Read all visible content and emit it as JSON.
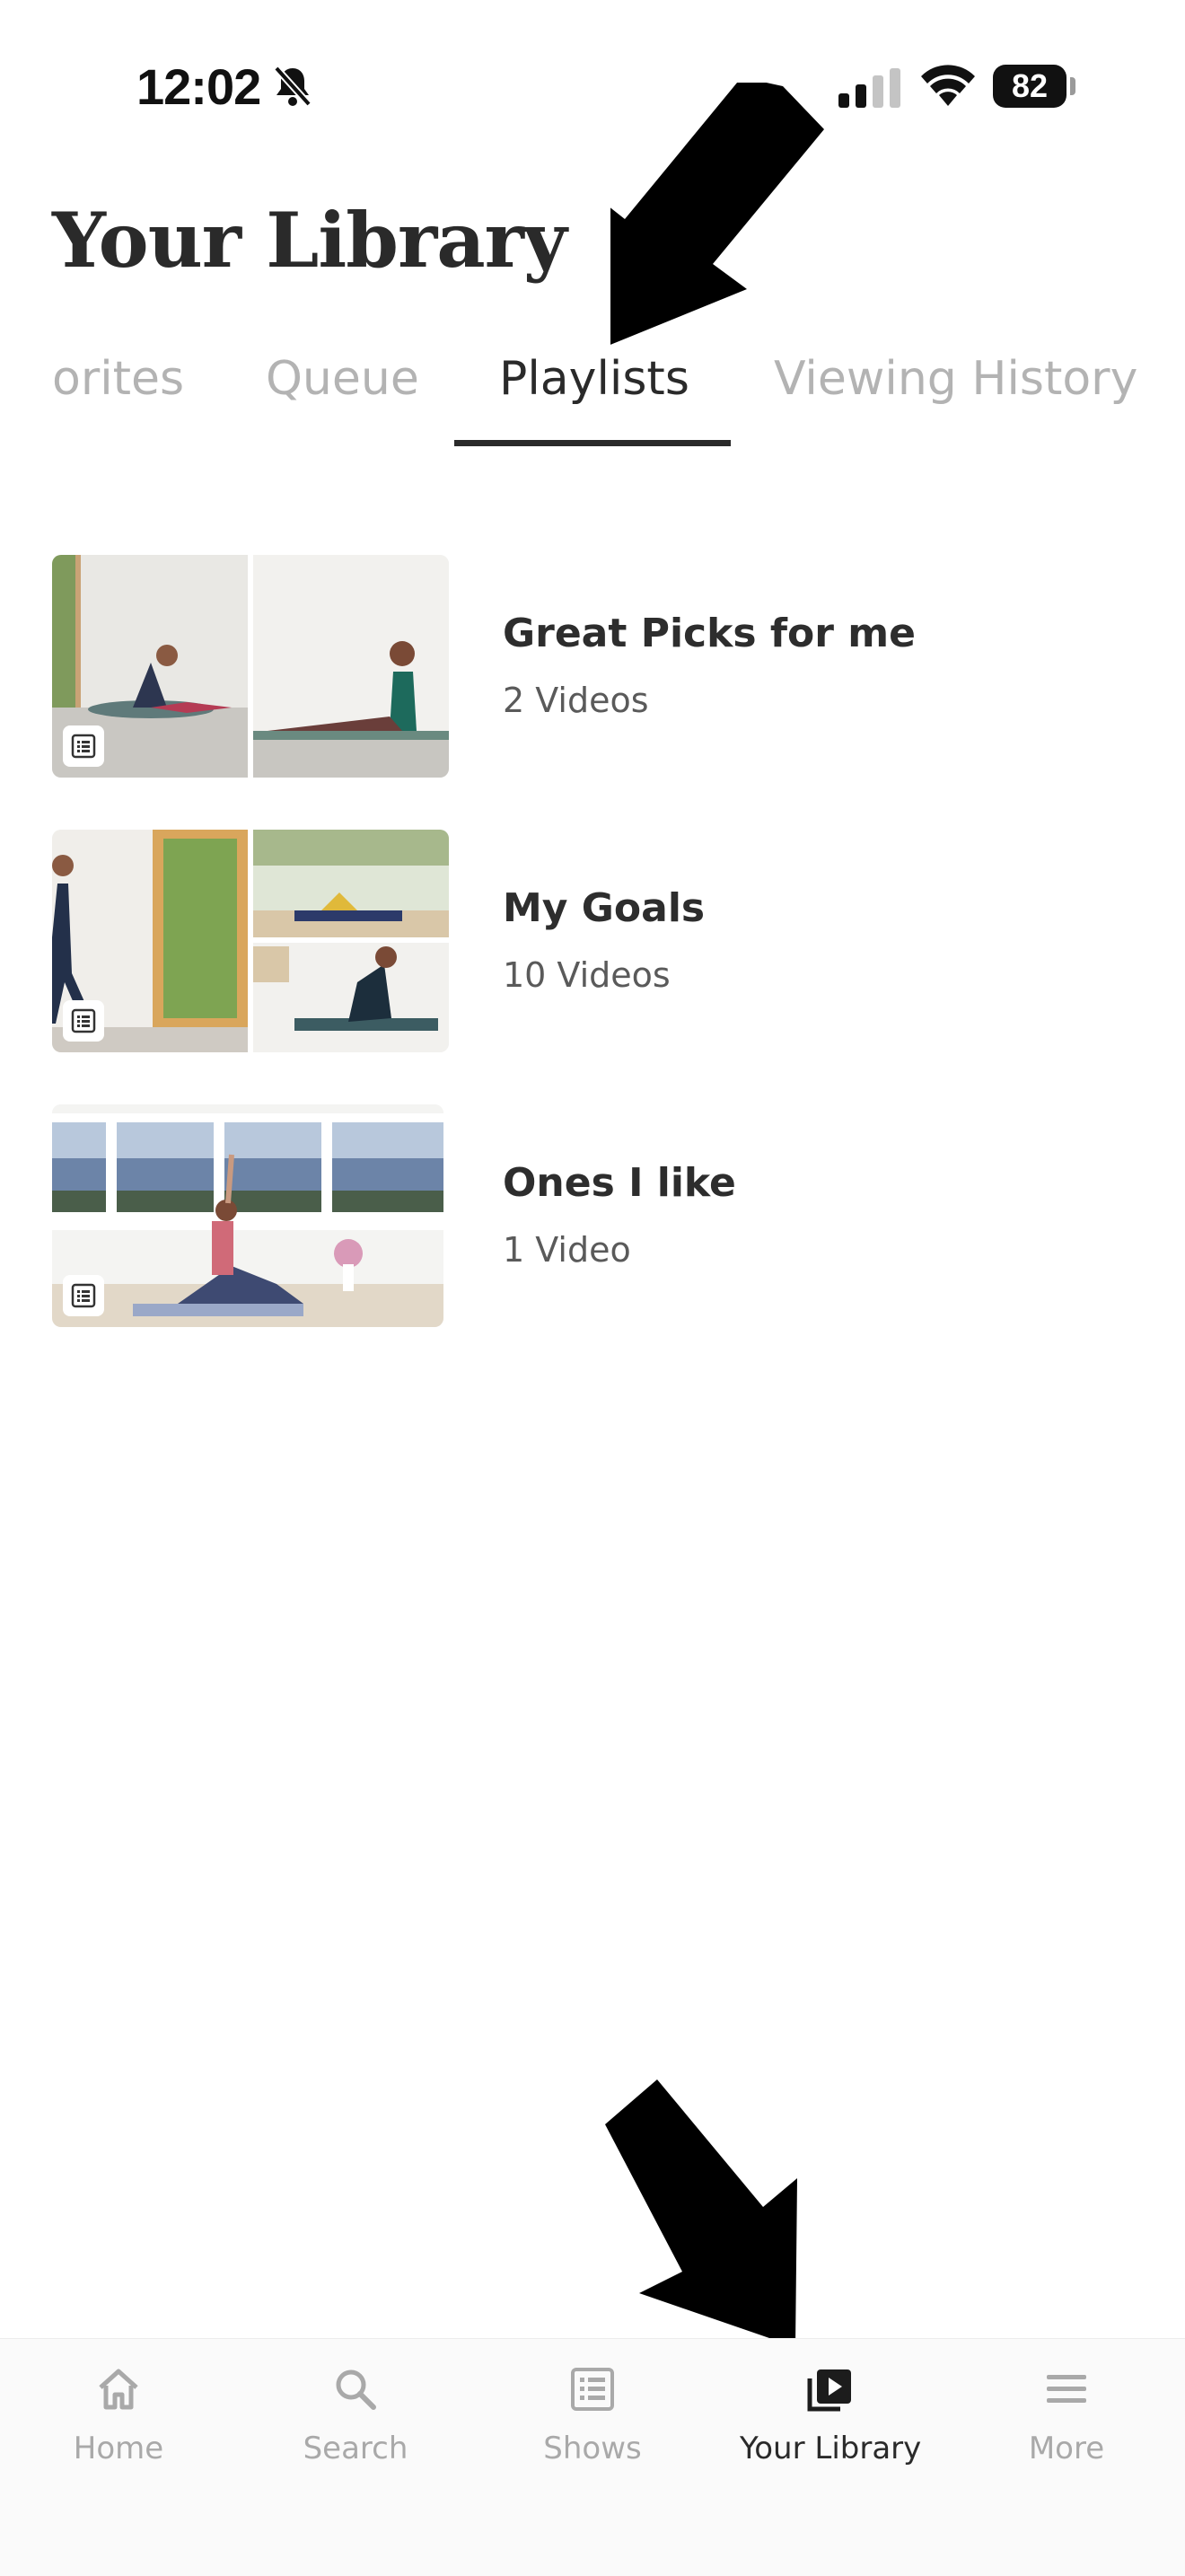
{
  "status_bar": {
    "time": "12:02",
    "battery": "82"
  },
  "header": {
    "title": "Your Library"
  },
  "tabs": [
    {
      "label": "orites"
    },
    {
      "label": "Queue"
    },
    {
      "label": "Playlists",
      "active": true
    },
    {
      "label": "Viewing History"
    }
  ],
  "playlists": [
    {
      "title": "Great Picks for me",
      "count": "2 Videos",
      "icon": "playlist-icon"
    },
    {
      "title": "My Goals",
      "count": "10 Videos",
      "icon": "playlist-icon"
    },
    {
      "title": "Ones I like",
      "count": "1 Video",
      "icon": "playlist-icon"
    }
  ],
  "bottom_nav": [
    {
      "label": "Home",
      "icon": "home-icon"
    },
    {
      "label": "Search",
      "icon": "search-icon"
    },
    {
      "label": "Shows",
      "icon": "shows-icon"
    },
    {
      "label": "Your Library",
      "icon": "library-icon",
      "active": true
    },
    {
      "label": "More",
      "icon": "menu-icon"
    }
  ],
  "colors": {
    "text": "#2a2a2a",
    "inactive": "#b3b3b3",
    "background": "#ffffff"
  }
}
